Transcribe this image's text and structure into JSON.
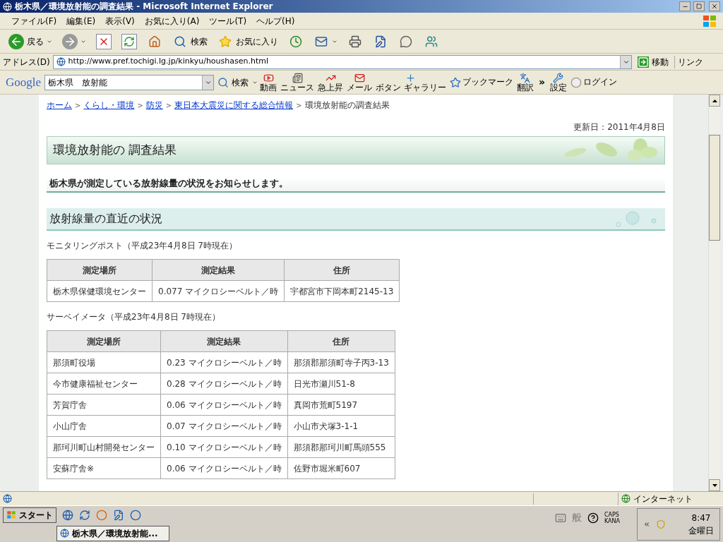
{
  "window": {
    "title": "栃木県／環境放射能の調査結果 - Microsoft Internet Explorer"
  },
  "menu_bar": [
    "ファイル(F)",
    "編集(E)",
    "表示(V)",
    "お気に入り(A)",
    "ツール(T)",
    "ヘルプ(H)"
  ],
  "toolbar": [
    {
      "kind": "back",
      "label": "戻る"
    },
    {
      "kind": "forward"
    },
    {
      "kind": "stop"
    },
    {
      "kind": "refresh"
    },
    {
      "kind": "home"
    },
    {
      "kind": "search",
      "label": "検索"
    },
    {
      "kind": "favorites",
      "label": "お気に入り"
    },
    {
      "kind": "history"
    },
    {
      "kind": "mail"
    },
    {
      "kind": "print"
    },
    {
      "kind": "edit"
    },
    {
      "kind": "discuss"
    },
    {
      "kind": "messenger"
    }
  ],
  "address_bar": {
    "label": "アドレス(D)",
    "url": "http://www.pref.tochigi.lg.jp/kinkyu/houshasen.html",
    "go": "移動",
    "links": "リンク"
  },
  "google_bar": {
    "logo": "Google",
    "query": "栃木県　放射能",
    "search": "検索",
    "buttons": [
      {
        "kind": "video",
        "label": "動画"
      },
      {
        "kind": "news",
        "label": "ニュース"
      },
      {
        "kind": "trend",
        "label": "急上昇"
      },
      {
        "kind": "mail",
        "label": "メール"
      },
      {
        "kind": "plus",
        "label": "ボタン ギャラリー"
      },
      {
        "kind": "star",
        "label": "ブックマーク"
      },
      {
        "kind": "translate",
        "label": "翻訳"
      },
      {
        "kind": "more",
        "label": "»"
      },
      {
        "kind": "wrench",
        "label": "設定"
      },
      {
        "kind": "login",
        "label": "ログイン"
      }
    ]
  },
  "page": {
    "breadcrumb": {
      "separator": ">",
      "items": [
        {
          "label": "ホーム",
          "link": true
        },
        {
          "label": "くらし・環境",
          "link": true
        },
        {
          "label": "防災",
          "link": true
        },
        {
          "label": "東日本大震災に関する総合情報",
          "link": true
        },
        {
          "label": "環境放射能の調査結果",
          "link": false
        }
      ]
    },
    "updated": "更新日：2011年4月8日",
    "title": "環境放射能の 調査結果",
    "lead": "栃木県が測定している放射線量の状況をお知らせします。",
    "section_title": "放射線量の直近の状況",
    "tables": [
      {
        "caption": "モニタリングポスト（平成23年4月8日 7時現在）",
        "columns": [
          "測定場所",
          "測定結果",
          "住所"
        ],
        "rows": [
          [
            "栃木県保健環境センター",
            "0.077 マイクロシーベルト／時",
            "宇都宮市下岡本町2145-13"
          ]
        ]
      },
      {
        "caption": "サーベイメータ（平成23年4月8日 7時現在）",
        "columns": [
          "測定場所",
          "測定結果",
          "住所"
        ],
        "rows": [
          [
            "那須町役場",
            "0.23 マイクロシーベルト／時",
            "那須郡那須町寺子丙3-13"
          ],
          [
            "今市健康福祉センター",
            "0.28 マイクロシーベルト／時",
            "日光市瀬川51-8"
          ],
          [
            "芳賀庁舎",
            "0.06 マイクロシーベルト／時",
            "真岡市荒町5197"
          ],
          [
            "小山庁舎",
            "0.07 マイクロシーベルト／時",
            "小山市犬塚3-1-1"
          ],
          [
            "那珂川町山村開発センター",
            "0.10 マイクロシーベルト／時",
            "那須郡那珂川町馬頭555"
          ],
          [
            "安蘇庁舎※",
            "0.06 マイクロシーベルト／時",
            "佐野市堀米町607"
          ]
        ]
      }
    ]
  },
  "status_bar": {
    "zone": "インターネット"
  },
  "taskbar": {
    "start": "スタート",
    "tasks": [
      {
        "label": "栃木県／環境放射能...",
        "selected": true
      }
    ],
    "ime": "般",
    "caps": "CAPS",
    "kana": "KANA",
    "time": "8:47",
    "day": "金曜日"
  }
}
